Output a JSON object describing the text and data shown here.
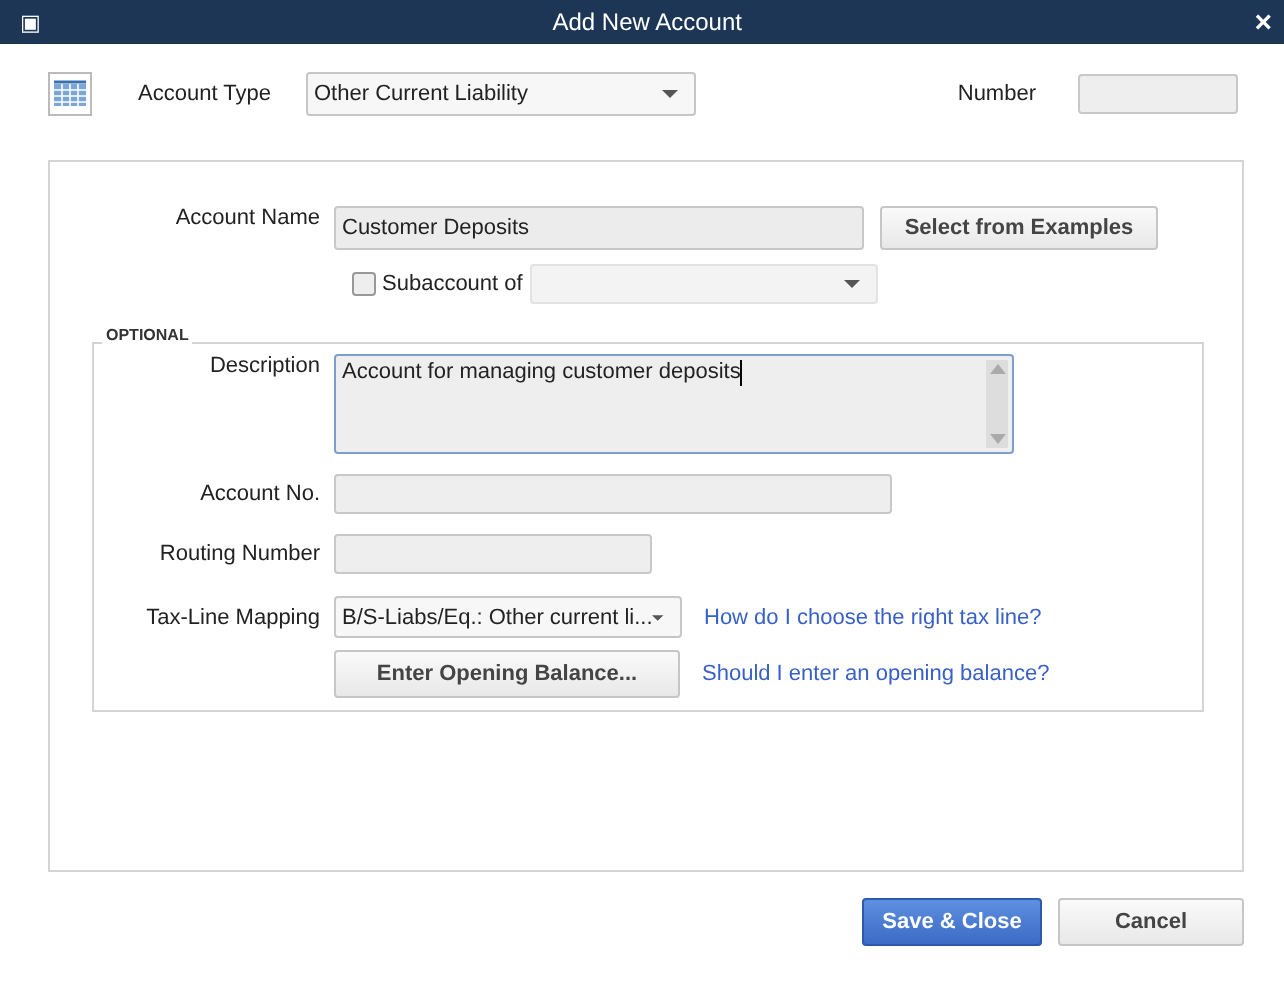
{
  "window": {
    "title": "Add New Account",
    "menu_icon": "▣",
    "close": "×"
  },
  "account_type": {
    "label": "Account Type",
    "value": "Other Current Liability"
  },
  "number": {
    "label": "Number"
  },
  "account_name": {
    "label": "Account Name",
    "value": "Customer Deposits",
    "button": "Select from Examples"
  },
  "subaccount": {
    "label": "Subaccount of",
    "checked": false
  },
  "optional": {
    "heading": "OPTIONAL",
    "description": {
      "label": "Description",
      "value": "Account for managing customer deposits"
    },
    "account_no": {
      "label": "Account No."
    },
    "routing_number": {
      "label": "Routing Number"
    },
    "tax_line": {
      "label": "Tax-Line Mapping",
      "value": "B/S-Liabs/Eq.: Other current li...",
      "link": "How do I choose the right tax line?"
    },
    "opening_balance": {
      "button": "Enter Opening Balance...",
      "link": "Should I enter an opening balance?"
    }
  },
  "buttons": [
    {
      "label": "Save & Close",
      "kind": "primary"
    },
    {
      "label": "Cancel",
      "kind": "normal"
    }
  ]
}
